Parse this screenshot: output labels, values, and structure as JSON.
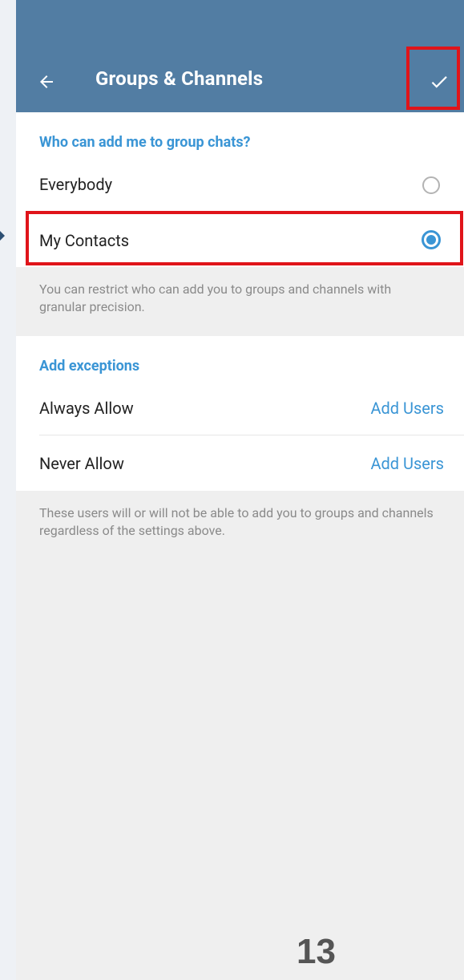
{
  "header": {
    "title": "Groups & Channels",
    "back_icon": "back-arrow-icon",
    "confirm_icon": "check-icon",
    "background_color": "#527da3"
  },
  "who_can_add": {
    "section_title": "Who can add me to group chats?",
    "options": [
      {
        "label": "Everybody",
        "selected": false
      },
      {
        "label": "My Contacts",
        "selected": true
      }
    ],
    "hint": "You can restrict who can add you to groups and channels with granular precision."
  },
  "exceptions": {
    "section_title": "Add exceptions",
    "rows": [
      {
        "label": "Always Allow",
        "action": "Add Users"
      },
      {
        "label": "Never Allow",
        "action": "Add Users"
      }
    ],
    "hint": "These users will or will not be able to add you to groups and channels regardless of the settings above."
  },
  "annotations": {
    "highlight_color": "#e0141a",
    "page_number": "13"
  },
  "colors": {
    "accent": "#3a95d5",
    "page_background": "#efefef"
  }
}
